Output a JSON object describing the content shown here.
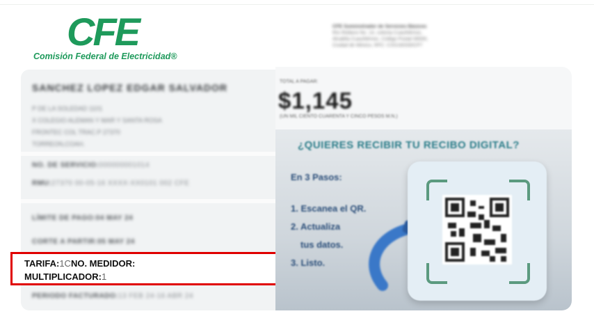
{
  "logo": {
    "mark": "CFE",
    "name": "Comisión Federal de Electricidad"
  },
  "issuer": {
    "lines": [
      "CFE Suministrador de Servicios Básicos",
      "Río Ródano No. 14, colonia Cuauhtémoc,",
      "Alcaldía Cuauhtémoc, Código Postal 06500,",
      "Ciudad de México, RFC: CSS160330CP7"
    ]
  },
  "customer": {
    "name": "SANCHEZ LOPEZ EDGAR SALVADOR",
    "address": [
      "P DE LA SOLEDAD 1101",
      "X COLEGIO ALEMAN Y MAR Y SANTA ROSA",
      "FRONTEC COL TRAC.P 27370",
      "TORREON,COAH."
    ]
  },
  "service": {
    "no_servicio_label": "NO. DE SERVICIO:",
    "no_servicio": "000000001014",
    "rmu_label": "RMU:",
    "rmu": "27370 00-05-16 XXXX-XX0101 002 CFE"
  },
  "dates": {
    "limite_label": "LÍMITE DE PAGO:",
    "limite": "04 MAY 24",
    "corte_label": "CORTE A PARTIR:",
    "corte": "05 MAY 24",
    "periodo_label": "PERIODO FACTURADO:",
    "periodo": "13 FEB 24-16 ABR 24"
  },
  "meter": {
    "tarifa_label": "TARIFA:",
    "tarifa": "1C",
    "medidor_label": "NO. MEDIDOR:",
    "medidor": "",
    "multiplicador_label": "MULTIPLICADOR:",
    "multiplicador": "1"
  },
  "total": {
    "label": "TOTAL A PAGAR:",
    "amount": "$1,145",
    "in_words": "(UN MIL CIENTO CUARENTA Y CINCO PESOS M.N.)"
  },
  "promo": {
    "title": "¿QUIERES RECIBIR TU RECIBO DIGITAL?",
    "steps_heading": "En 3 Pasos:",
    "steps": [
      "1. Escanea el QR.",
      "2. Actualiza",
      "tus datos.",
      "3. Listo."
    ]
  },
  "colors": {
    "brand_green": "#1e9a5b",
    "highlight_red": "#e00000",
    "promo_teal": "#2d7e8a",
    "promo_navy": "#2c4f7a"
  }
}
